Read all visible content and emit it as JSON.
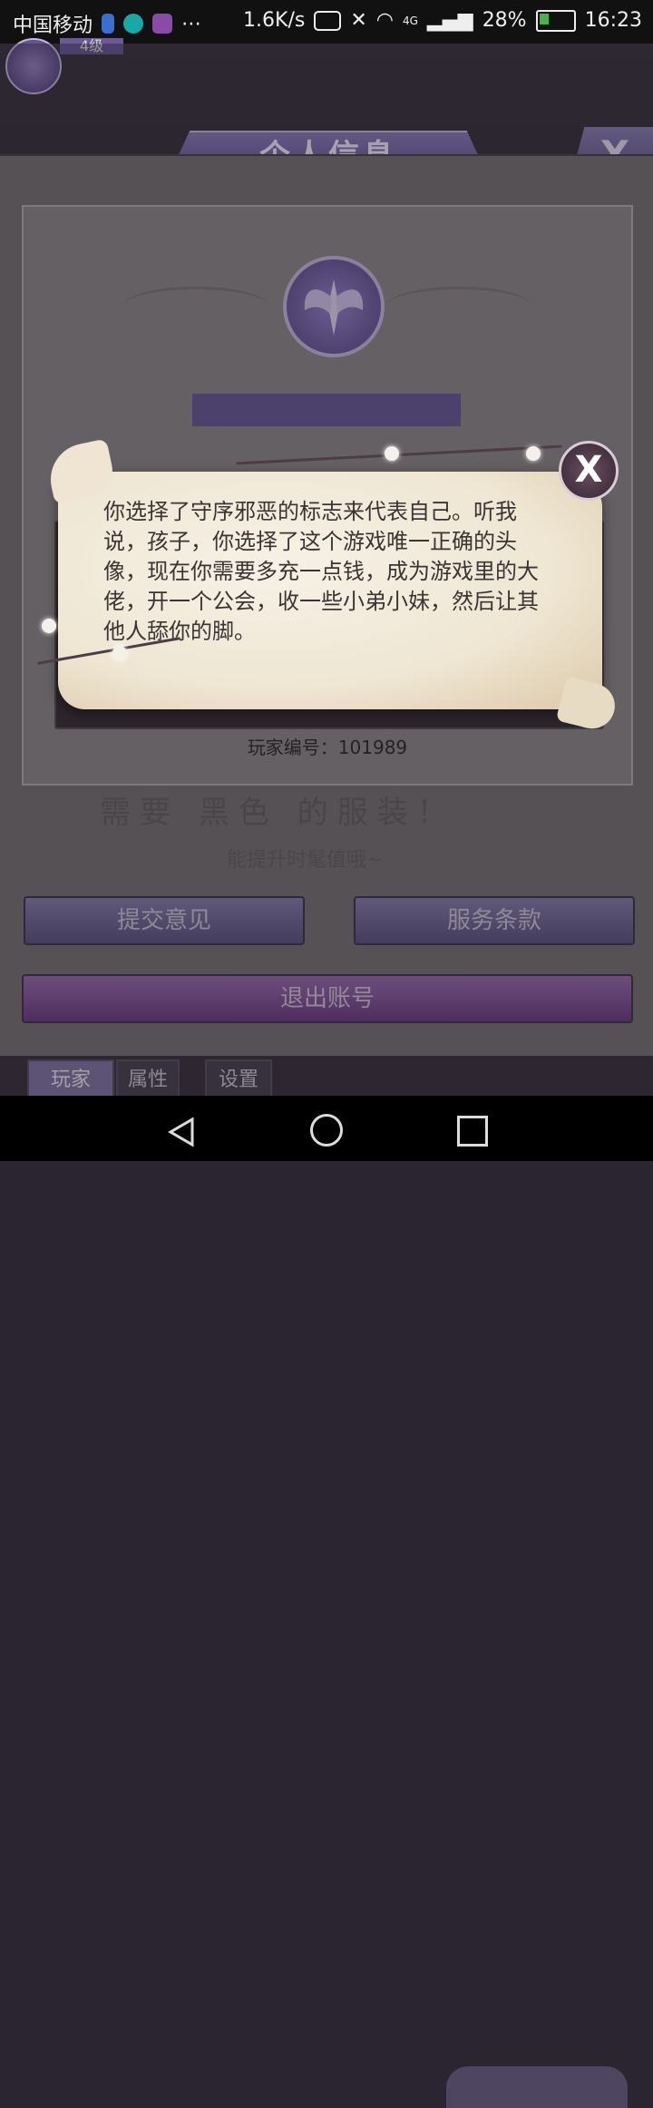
{
  "status_bar": {
    "carrier": "中国移动",
    "speed": "1.6K/s",
    "network": "4G",
    "battery": "28%",
    "time": "16:23"
  },
  "player_level": "4级",
  "panel": {
    "title": "个人信息",
    "close_label": "X",
    "player_id_label": "玩家编号：101989"
  },
  "background_text": {
    "line1": "需要 黑色 的服装！",
    "line2": "能提升时髦值哦~"
  },
  "buttons": {
    "feedback": "提交意见",
    "terms": "服务条款",
    "logout": "退出账号"
  },
  "tabs": [
    {
      "label": "玩家"
    },
    {
      "label": "属性"
    },
    {
      "label": "设置"
    }
  ],
  "popup": {
    "text": "你选择了守序邪恶的标志来代表自己。听我说，孩子，你选择了这个游戏唯一正确的头像，现在你需要多充一点钱，成为游戏里的大佬，开一个公会，收一些小弟小妹，然后让其他人舔你的脚。",
    "close_label": "X"
  },
  "colors": {
    "accent_purple": "#6b5a9a",
    "logout_purple": "#7d4a95",
    "parchment": "#efe6d3"
  }
}
